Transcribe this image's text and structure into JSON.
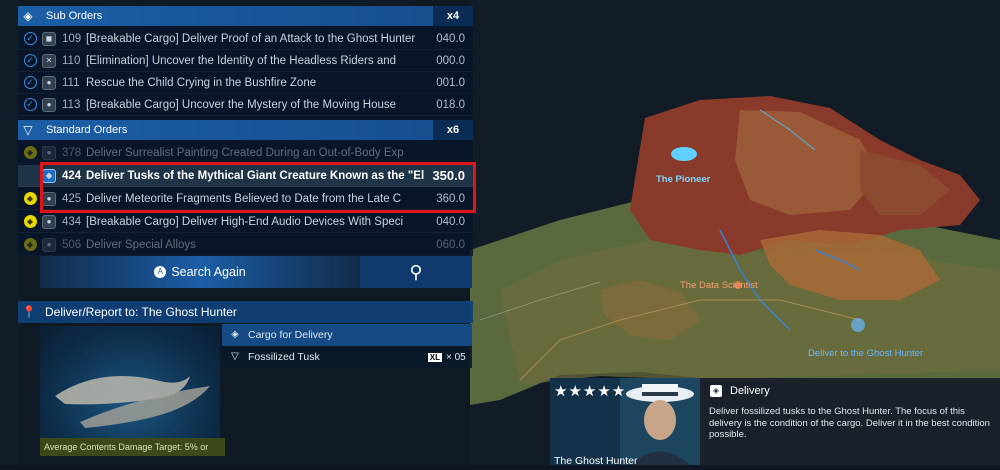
{
  "sub_orders": {
    "title": "Sub Orders",
    "count": "x4",
    "items": [
      {
        "num": "109",
        "title": "[Breakable Cargo] Deliver Proof of an Attack to the Ghost Hunter",
        "value": "040.0"
      },
      {
        "num": "110",
        "title": "[Elimination] Uncover the Identity of the Headless Riders and",
        "value": "000.0"
      },
      {
        "num": "111",
        "title": "Rescue the Child Crying in the Bushfire Zone",
        "value": "001.0"
      },
      {
        "num": "113",
        "title": "[Breakable Cargo] Uncover the Mystery of the Moving House",
        "value": "018.0"
      }
    ]
  },
  "standard_orders": {
    "title": "Standard Orders",
    "count": "x6",
    "items": [
      {
        "num": "378",
        "title": "Deliver Surrealist Painting Created During an Out-of-Body Exp",
        "value": ""
      },
      {
        "num": "424",
        "title": "Deliver Tusks of the Mythical Giant Creature Known as the \"El",
        "value": "350.0"
      },
      {
        "num": "425",
        "title": "Deliver Meteorite Fragments Believed to Date from the Late C",
        "value": "360.0"
      },
      {
        "num": "434",
        "title": "[Breakable Cargo] Deliver High-End Audio Devices With Speci",
        "value": "040.0"
      },
      {
        "num": "506",
        "title": "Deliver Special Alloys",
        "value": "060.0"
      }
    ]
  },
  "search": {
    "label": "Search Again",
    "button_glyph": "A"
  },
  "deliver_to": {
    "label": "Deliver/Report to: The Ghost Hunter"
  },
  "cargo": {
    "header": "Cargo for Delivery",
    "item_name": "Fossilized Tusk",
    "size": "XL",
    "quantity": "× 05",
    "damage_target": "Average Contents Damage Target: 5% or"
  },
  "client": {
    "name": "The Ghost Hunter",
    "rating": "★★★★★"
  },
  "delivery": {
    "title": "Delivery",
    "description": "Deliver fossilized tusks to the Ghost Hunter. The focus of this delivery is the condition of the cargo. Deliver it in the best condition possible."
  },
  "map_labels": {
    "pioneer": "The Pioneer",
    "data_scientist": "The Data Scientist",
    "deliver_to_hunter": "Deliver to the Ghost Hunter"
  }
}
